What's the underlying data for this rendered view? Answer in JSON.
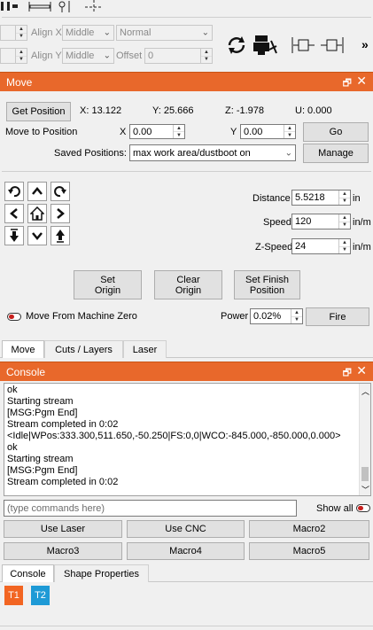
{
  "toolbar": {
    "align_x_label": "Align X",
    "align_y_label": "Align Y",
    "align_x_value": "Middle",
    "align_y_value": "Middle",
    "mode_value": "Normal",
    "offset_label": "Offset",
    "offset_value": "0",
    "more_label": "»",
    "icons": [
      "align-icon",
      "distribute-icon",
      "transform-icon",
      "rotate-icon",
      "laser-icon",
      "dock-left-icon",
      "dock-right-icon"
    ]
  },
  "move_panel": {
    "title": "Move",
    "get_position_label": "Get Position",
    "x_pos": "X: 13.122",
    "y_pos": "Y: 25.666",
    "z_pos": "Z: -1.978",
    "u_pos": "U: 0.000",
    "move_to_label": "Move to Position",
    "x_label": "X",
    "x_value": "0.00",
    "y_label": "Y",
    "y_value": "0.00",
    "go_label": "Go",
    "saved_positions_label": "Saved Positions:",
    "saved_positions_value": "max work area/dustboot on",
    "manage_label": "Manage",
    "distance_label": "Distance",
    "distance_value": "5.5218",
    "distance_unit": "in",
    "speed_label": "Speed",
    "speed_value": "120",
    "speed_unit": "in/m",
    "zspeed_label": "Z-Speed",
    "zspeed_value": "24",
    "zspeed_unit": "in/m",
    "set_origin_line1": "Set",
    "set_origin_line2": "Origin",
    "clear_origin_line1": "Clear",
    "clear_origin_line2": "Origin",
    "set_finish_line1": "Set Finish",
    "set_finish_line2": "Position",
    "move_from_zero_label": "Move From Machine Zero",
    "power_label": "Power",
    "power_value": "0.02%",
    "fire_label": "Fire"
  },
  "upper_tabs": [
    {
      "label": "Move"
    },
    {
      "label": "Cuts / Layers"
    },
    {
      "label": "Laser"
    }
  ],
  "console_panel": {
    "title": "Console",
    "lines": [
      "ok",
      "Starting stream",
      "[MSG:Pgm End]",
      "Stream completed in 0:02",
      "<Idle|WPos:333.300,511.650,-50.250|FS:0,0|WCO:-845.000,-850.000,0.000>",
      "ok",
      "Starting stream",
      "[MSG:Pgm End]",
      "Stream completed in 0:02"
    ],
    "command_placeholder": "(type commands here)",
    "show_all_label": "Show all",
    "macros": [
      "Use Laser",
      "Use CNC",
      "Macro2",
      "Macro3",
      "Macro4",
      "Macro5"
    ]
  },
  "lower_tabs": [
    {
      "label": "Console"
    },
    {
      "label": "Shape Properties"
    }
  ],
  "tools": [
    {
      "label": "T1",
      "color": "#f26522"
    },
    {
      "label": "T2",
      "color": "#1e9ad6"
    }
  ],
  "colors": {
    "title_bar": "#e8682b",
    "toggle_off": "#c8201e"
  }
}
